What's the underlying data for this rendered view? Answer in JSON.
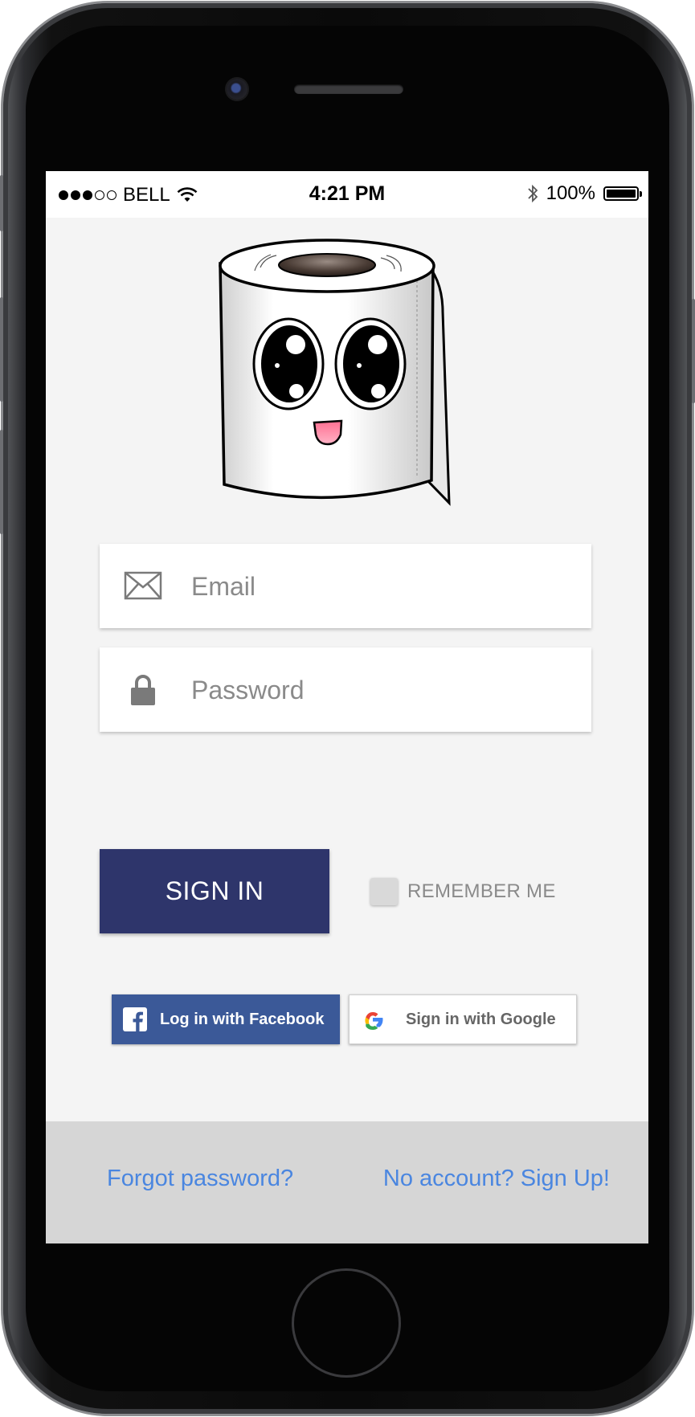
{
  "status_bar": {
    "carrier": "BELL",
    "time": "4:21 PM",
    "battery": "100%",
    "signal_bars": 3,
    "signal_total": 5,
    "icons": [
      "wifi-icon",
      "bluetooth-icon",
      "battery-icon"
    ]
  },
  "login": {
    "email_placeholder": "Email",
    "password_placeholder": "Password",
    "signin_label": "SIGN IN",
    "remember_label": "REMEMBER ME",
    "remember_checked": false
  },
  "social": {
    "facebook_label": "Log in with Facebook",
    "google_label": "Sign in with Google"
  },
  "footer": {
    "forgot_label": "Forgot password?",
    "signup_label": "No account? Sign Up!"
  },
  "colors": {
    "primary": "#2e356b",
    "facebook": "#3b5998",
    "link": "#4a86e0",
    "screen_bg": "#f4f4f4",
    "footer_bg": "#d6d6d6"
  }
}
